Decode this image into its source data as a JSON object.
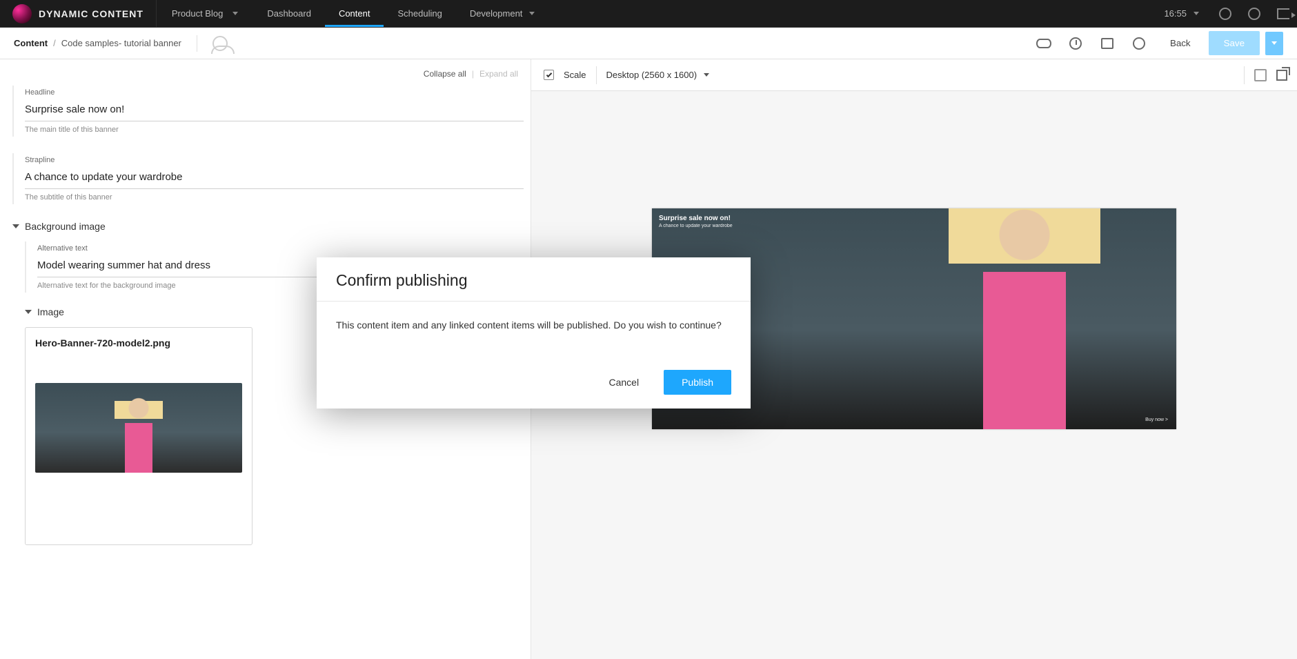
{
  "brand": "DYNAMIC CONTENT",
  "blog_selector": "Product Blog",
  "top_nav": {
    "dashboard": "Dashboard",
    "content": "Content",
    "scheduling": "Scheduling",
    "development": "Development"
  },
  "clock": "16:55",
  "breadcrumb": {
    "root": "Content",
    "sep": "/",
    "path": "Code samples- tutorial banner"
  },
  "subbar": {
    "back": "Back",
    "save": "Save"
  },
  "form": {
    "controls": {
      "collapse": "Collapse all",
      "pipe": "|",
      "expand": "Expand all"
    },
    "headline": {
      "label": "Headline",
      "value": "Surprise sale now on!",
      "help": "The main title of this banner"
    },
    "strapline": {
      "label": "Strapline",
      "value": "A chance to update your wardrobe",
      "help": "The subtitle of this banner"
    },
    "bg_section": "Background image",
    "alt": {
      "label": "Alternative text",
      "value": "Model wearing summer hat and dress",
      "help": "Alternative text for the background image"
    },
    "image_section": "Image",
    "image_file": "Hero-Banner-720-model2.png"
  },
  "preview": {
    "scale_label": "Scale",
    "scale_checked": true,
    "device": "Desktop (2560 x 1600)",
    "hero": {
      "headline": "Surprise sale now on!",
      "strapline": "A chance to update your wardrobe",
      "cta": "Buy now >"
    }
  },
  "modal": {
    "title": "Confirm publishing",
    "body": "This content item and any linked content items will be published. Do you wish to continue?",
    "cancel": "Cancel",
    "publish": "Publish"
  }
}
